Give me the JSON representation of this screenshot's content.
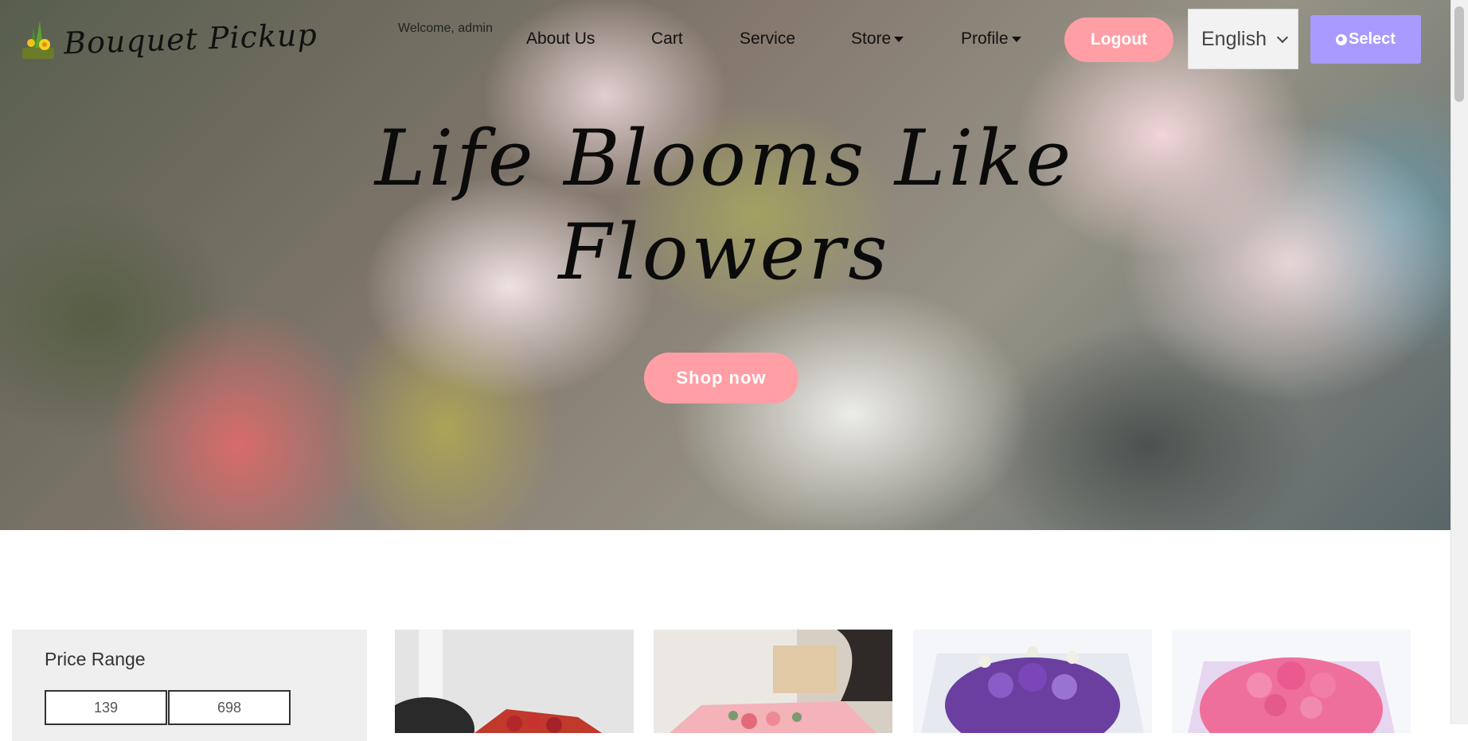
{
  "header": {
    "brand": "Bouquet Pickup",
    "welcome": "Welcome, admin",
    "nav": {
      "about": "About Us",
      "cart": "Cart",
      "service": "Service",
      "store": "Store",
      "profile": "Profile"
    },
    "logout": "Logout",
    "language": "English",
    "select": "Select"
  },
  "hero": {
    "title": "Life Blooms Like Flowers",
    "cta": "Shop now"
  },
  "filter": {
    "title": "Price Range",
    "min": "139",
    "max": "698"
  },
  "colors": {
    "accent_pink": "#ff9fa5",
    "accent_purple": "#a99aff"
  },
  "products": [
    {
      "image": "red-roses-bouquet"
    },
    {
      "image": "pink-roses-bouquet"
    },
    {
      "image": "purple-lisianthus-bouquet"
    },
    {
      "image": "pink-carnation-bouquet"
    }
  ]
}
